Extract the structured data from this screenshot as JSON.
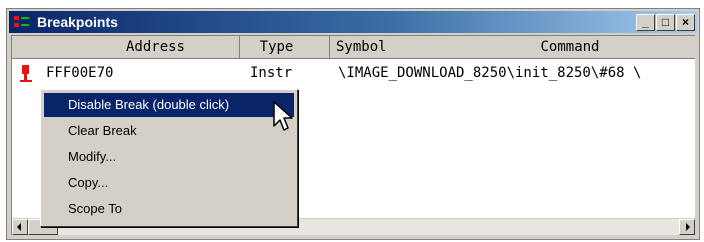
{
  "window": {
    "title": "Breakpoints",
    "buttons": {
      "minimize": "_",
      "maximize": "□",
      "close": "×"
    }
  },
  "columns": {
    "address": "Address",
    "type": "Type",
    "symbol": "Symbol",
    "command": "Command"
  },
  "rows": [
    {
      "icon": "breakpoint-marker-icon",
      "address": "FFF00E70",
      "type": "Instr",
      "symbol": "\\IMAGE_DOWNLOAD_8250\\init_8250\\#68 \\"
    }
  ],
  "context_menu": {
    "items": [
      {
        "label": "Disable Break (double click)",
        "highlighted": true
      },
      {
        "label": "Clear Break",
        "highlighted": false
      },
      {
        "label": "Modify...",
        "highlighted": false
      },
      {
        "label": "Copy...",
        "highlighted": false
      },
      {
        "label": "Scope To",
        "highlighted": false
      }
    ]
  },
  "colors": {
    "title_gradient_start": "#0a246a",
    "title_gradient_end": "#a6caf0",
    "menu_highlight": "#0a246a",
    "breakpoint_marker": "#e0161b"
  }
}
